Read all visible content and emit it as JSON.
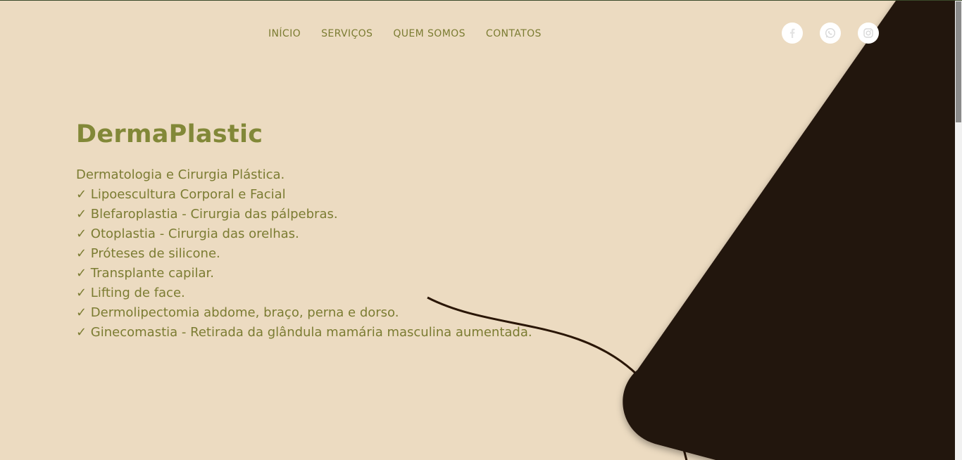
{
  "colors": {
    "background": "#ecdbc1",
    "accent": "#828838",
    "text": "#7b7c32",
    "dark_shape": "#221208"
  },
  "nav": {
    "items": [
      {
        "label": "INÍCIO"
      },
      {
        "label": "SERVIÇOS"
      },
      {
        "label": "QUEM SOMOS"
      },
      {
        "label": "CONTATOS"
      }
    ]
  },
  "social": {
    "icons": [
      "facebook-icon",
      "whatsapp-icon",
      "instagram-icon"
    ]
  },
  "hero": {
    "title": "DermaPlastic",
    "lines": [
      "Dermatologia e Cirurgia Plástica.",
      "✓ Lipoescultura Corporal e Facial",
      "✓ Blefaroplastia - Cirurgia das pálpebras.",
      "✓ Otoplastia - Cirurgia das orelhas.",
      "✓ Próteses de silicone.",
      "✓ Transplante capilar.",
      "✓ Lifting de face.",
      "✓ Dermolipectomia abdome, braço, perna e dorso.",
      "✓ Ginecomastia - Retirada da glândula mamária masculina aumentada."
    ]
  }
}
